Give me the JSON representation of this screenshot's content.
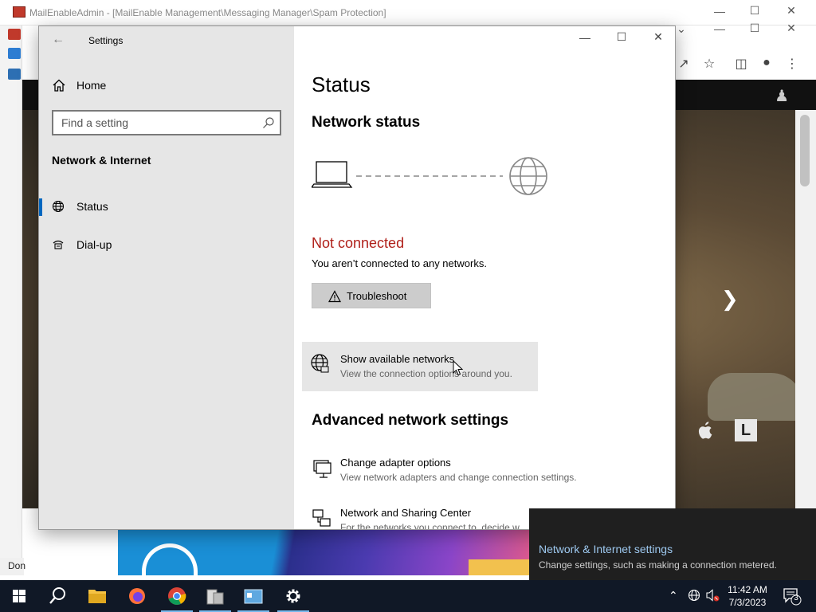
{
  "background": {
    "mmc_title": "MailEnableAdmin - [MailEnable Management\\Messaging Manager\\Spam Protection]",
    "mmc_status": "Don"
  },
  "settings": {
    "window_title": "Settings",
    "nav": {
      "home": "Home",
      "search_placeholder": "Find a setting",
      "section": "Network & Internet",
      "items": [
        {
          "label": "Status",
          "icon": "globe-icon",
          "selected": true
        },
        {
          "label": "Dial-up",
          "icon": "dialup-icon",
          "selected": false
        }
      ]
    },
    "content": {
      "title": "Status",
      "network_status_heading": "Network status",
      "not_connected": "Not connected",
      "not_connected_desc": "You aren’t connected to any networks.",
      "troubleshoot_label": "Troubleshoot",
      "show_networks": {
        "title": "Show available networks",
        "desc": "View the connection options around you."
      },
      "advanced_heading": "Advanced network settings",
      "links": [
        {
          "title": "Change adapter options",
          "desc": "View network adapters and change connection settings."
        },
        {
          "title": "Network and Sharing Center",
          "desc": "For the networks you connect to, decide w"
        }
      ]
    }
  },
  "toast": {
    "title": "Network & Internet settings",
    "desc": "Change settings, such as making a connection metered."
  },
  "taskbar": {
    "time": "11:42 AM",
    "date": "7/3/2023",
    "notification_count": "3",
    "apps": [
      "start",
      "search",
      "file-explorer",
      "firefox",
      "chrome",
      "server-manager",
      "mmc",
      "settings"
    ]
  },
  "colors": {
    "accent": "#0067c0",
    "error": "#b0201a",
    "taskbar": "#101826"
  }
}
